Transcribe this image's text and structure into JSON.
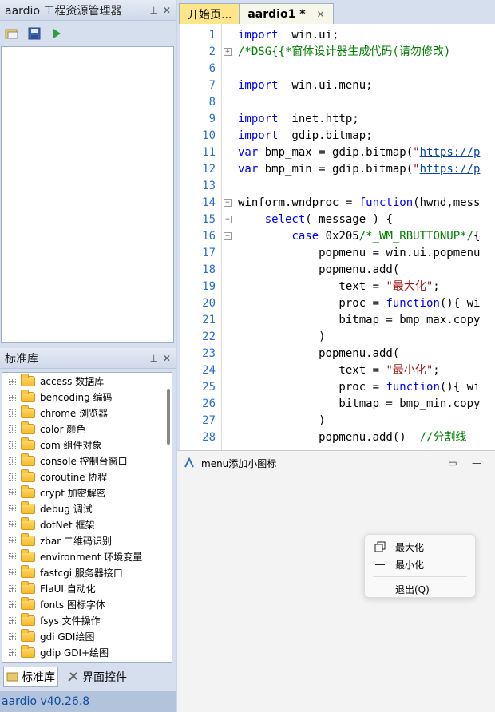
{
  "app": {
    "explorer_title": "aardio 工程资源管理器",
    "library_title": "标准库",
    "version_link": "aardio v40.26.8",
    "bottom_tabs": [
      "标准库",
      "界面控件"
    ]
  },
  "library": [
    "access 数据库",
    "bencoding 编码",
    "chrome 浏览器",
    "color 颜色",
    "com 组件对象",
    "console 控制台窗口",
    "coroutine 协程",
    "crypt 加密解密",
    "debug 调试",
    "dotNet 框架",
    "zbar 二维码识别",
    "environment 环境变量",
    "fastcgi 服务器接口",
    "FlaUI 自动化",
    "fonts 图标字体",
    "fsys 文件操作",
    "gdi GDI绘图",
    "gdip GDI+绘图"
  ],
  "editor": {
    "tabs": [
      {
        "label": "开始页..."
      },
      {
        "label": "aardio1 *"
      }
    ],
    "lines": [
      {
        "n": "1",
        "tokens": [
          [
            "kw",
            "import"
          ],
          [
            "",
            "  win.ui;"
          ]
        ]
      },
      {
        "n": "2",
        "fold": "+",
        "tokens": [
          [
            "cm",
            "/*DSG{{*窗体设计器生成代码(请勿修改)"
          ]
        ]
      },
      {
        "n": "6",
        "tokens": []
      },
      {
        "n": "7",
        "tokens": [
          [
            "kw",
            "import"
          ],
          [
            "",
            "  win.ui.menu;"
          ]
        ]
      },
      {
        "n": "8",
        "tokens": []
      },
      {
        "n": "9",
        "tokens": [
          [
            "kw",
            "import"
          ],
          [
            "",
            "  inet.http;"
          ]
        ]
      },
      {
        "n": "10",
        "tokens": [
          [
            "kw",
            "import"
          ],
          [
            "",
            "  gdip.bitmap;"
          ]
        ]
      },
      {
        "n": "11",
        "tokens": [
          [
            "kw",
            "var"
          ],
          [
            "",
            " bmp_max = gdip.bitmap("
          ],
          [
            "str",
            "\""
          ],
          [
            "url",
            "https://p"
          ]
        ]
      },
      {
        "n": "12",
        "tokens": [
          [
            "kw",
            "var"
          ],
          [
            "",
            " bmp_min = gdip.bitmap("
          ],
          [
            "str",
            "\""
          ],
          [
            "url",
            "https://p"
          ]
        ]
      },
      {
        "n": "13",
        "tokens": []
      },
      {
        "n": "14",
        "fold": "-",
        "tokens": [
          [
            "",
            "winform.wndproc = "
          ],
          [
            "kw",
            "function"
          ],
          [
            "",
            "(hwnd,mess"
          ]
        ]
      },
      {
        "n": "15",
        "fold": "-",
        "tokens": [
          [
            "",
            "    "
          ],
          [
            "kw",
            "select"
          ],
          [
            "",
            "( message ) {"
          ]
        ]
      },
      {
        "n": "16",
        "fold": "-",
        "tokens": [
          [
            "",
            "        "
          ],
          [
            "kw",
            "case"
          ],
          [
            "",
            " 0x205"
          ],
          [
            "cm",
            "/*_WM_RBUTTONUP*/"
          ],
          [
            "",
            "{"
          ]
        ]
      },
      {
        "n": "17",
        "tokens": [
          [
            "",
            "            popmenu = win.ui.popmenu"
          ]
        ]
      },
      {
        "n": "18",
        "tokens": [
          [
            "",
            "            popmenu.add("
          ]
        ]
      },
      {
        "n": "19",
        "tokens": [
          [
            "",
            "               text = "
          ],
          [
            "str",
            "\"最大化\""
          ],
          [
            "",
            ";"
          ]
        ]
      },
      {
        "n": "20",
        "tokens": [
          [
            "",
            "               proc = "
          ],
          [
            "kw",
            "function"
          ],
          [
            "",
            "(){ wi"
          ]
        ]
      },
      {
        "n": "21",
        "tokens": [
          [
            "",
            "               bitmap = bmp_max.copy"
          ]
        ]
      },
      {
        "n": "22",
        "tokens": [
          [
            "",
            "            )"
          ]
        ]
      },
      {
        "n": "23",
        "tokens": [
          [
            "",
            "            popmenu.add("
          ]
        ]
      },
      {
        "n": "24",
        "tokens": [
          [
            "",
            "               text = "
          ],
          [
            "str",
            "\"最小化\""
          ],
          [
            "",
            ";"
          ]
        ]
      },
      {
        "n": "25",
        "tokens": [
          [
            "",
            "               proc = "
          ],
          [
            "kw",
            "function"
          ],
          [
            "",
            "(){ wi"
          ]
        ]
      },
      {
        "n": "26",
        "tokens": [
          [
            "",
            "               bitmap = bmp_min.copy"
          ]
        ]
      },
      {
        "n": "27",
        "tokens": [
          [
            "",
            "            )"
          ]
        ]
      },
      {
        "n": "28",
        "tokens": [
          [
            "",
            "            popmenu.add()  "
          ],
          [
            "cm",
            "//分割线"
          ]
        ]
      }
    ]
  },
  "popup": {
    "title": "menu添加小图标",
    "menu": [
      "最大化",
      "最小化",
      "退出(Q)"
    ]
  }
}
